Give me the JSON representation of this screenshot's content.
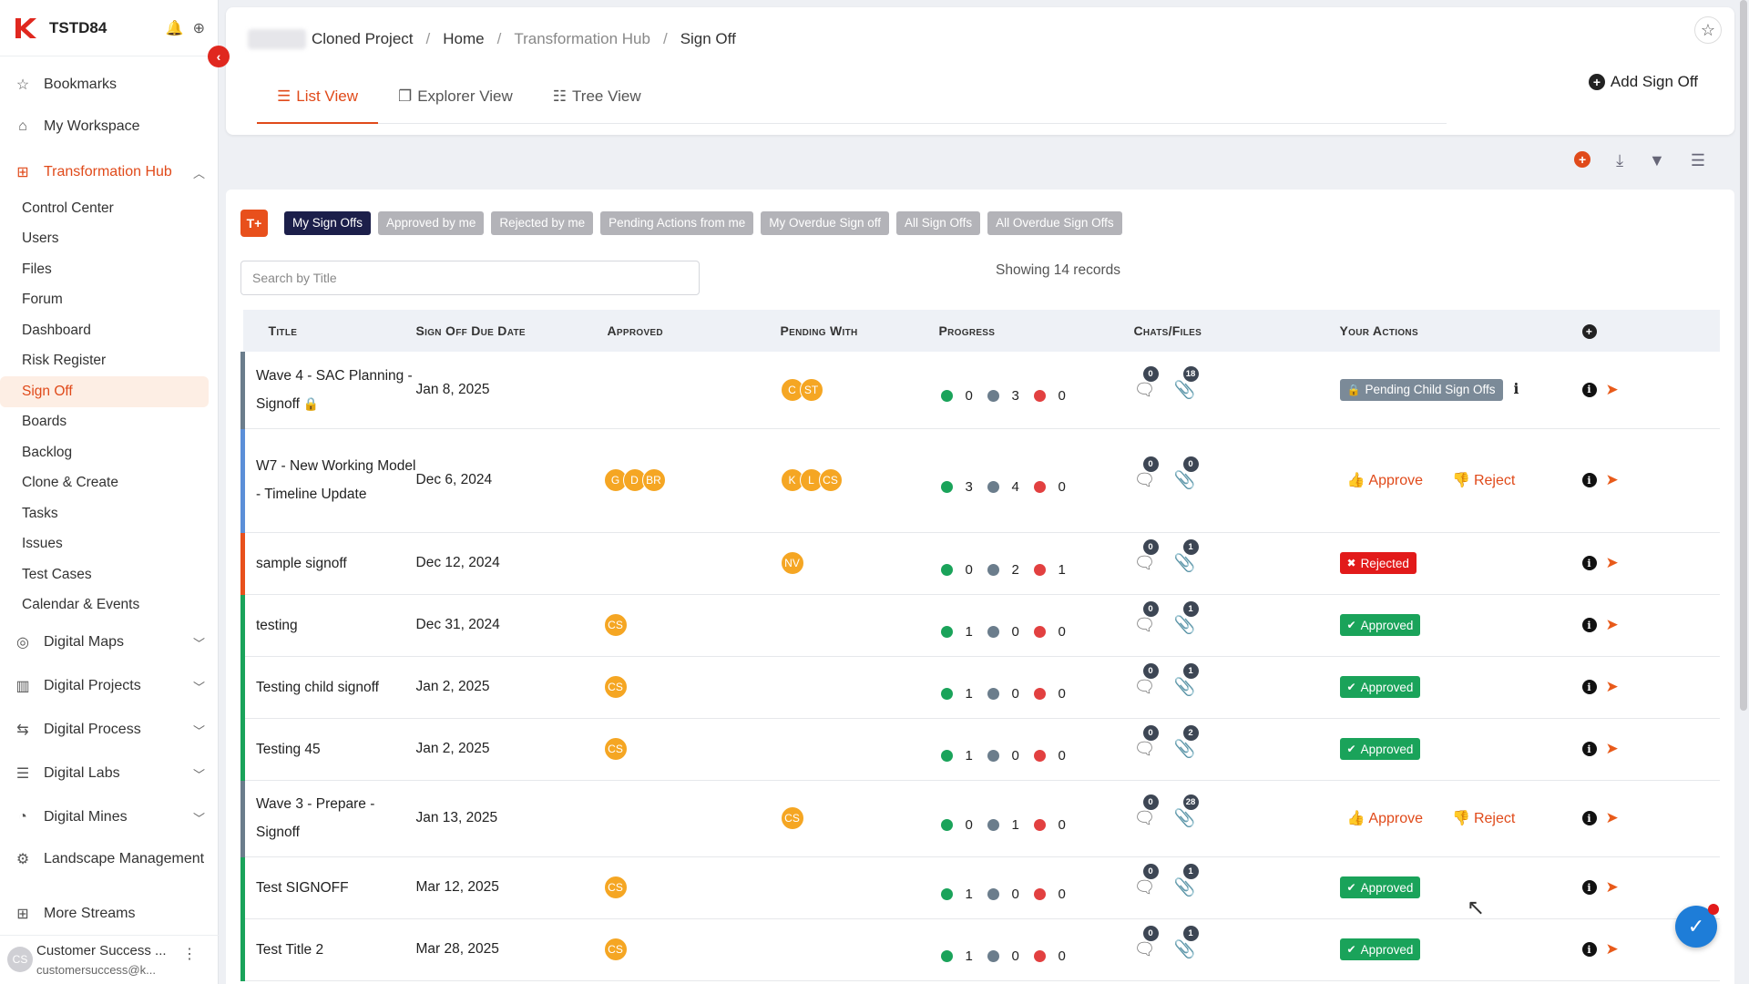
{
  "app": {
    "workspace": "TSTD84",
    "brand_color": "#e04a1a"
  },
  "sidebar": {
    "top_items": [
      {
        "label": "Bookmarks",
        "icon": "star-icon"
      },
      {
        "label": "My Workspace",
        "icon": "home-icon"
      }
    ],
    "hub": {
      "label": "Transformation Hub",
      "icon": "grid-icon"
    },
    "sub_items": [
      "Control Center",
      "Users",
      "Files",
      "Forum",
      "Dashboard",
      "Risk Register",
      "Sign Off",
      "Boards",
      "Backlog",
      "Clone & Create",
      "Tasks",
      "Issues",
      "Test Cases",
      "Calendar & Events"
    ],
    "active_sub": "Sign Off",
    "bottom_items": [
      {
        "label": "Digital Maps",
        "icon": "map-pin-icon"
      },
      {
        "label": "Digital Projects",
        "icon": "kanban-icon"
      },
      {
        "label": "Digital Process",
        "icon": "arrows-icon"
      },
      {
        "label": "Digital Labs",
        "icon": "list-icon"
      },
      {
        "label": "Digital Mines",
        "icon": "gauge-icon"
      },
      {
        "label": "Landscape Management",
        "icon": "gear-icon"
      },
      {
        "label": "More Streams",
        "icon": "grid-icon"
      }
    ],
    "user": {
      "initials": "CS",
      "name": "Customer Success ...",
      "email": "customersuccess@k..."
    }
  },
  "header": {
    "breadcrumb": [
      "Cloned Project",
      "Home",
      "Transformation Hub",
      "Sign Off"
    ],
    "tabs": [
      {
        "label": "List View",
        "icon": "list-icon"
      },
      {
        "label": "Explorer View",
        "icon": "box-icon"
      },
      {
        "label": "Tree View",
        "icon": "sitemap-icon"
      }
    ],
    "add_label": "Add Sign Off"
  },
  "filters": {
    "chips": [
      "My Sign Offs",
      "Approved by me",
      "Rejected by me",
      "Pending Actions from me",
      "My Overdue Sign off",
      "All Sign Offs",
      "All Overdue Sign Offs"
    ],
    "active": "My Sign Offs"
  },
  "search": {
    "placeholder": "Search by Title"
  },
  "records_label": "Showing 14 records",
  "table": {
    "columns": [
      "Title",
      "Sign Off Due Date",
      "Approved",
      "Pending With",
      "Progress",
      "Chats/Files",
      "Your Actions"
    ],
    "rows": [
      {
        "title": "Wave 4 - SAC Planning - Signoff",
        "locked": true,
        "bar": "#6b7d8c",
        "due": "Jan 8, 2025",
        "approved": [],
        "pending": [
          "C",
          "ST"
        ],
        "progress": [
          0,
          3,
          0
        ],
        "chats": 0,
        "files": 18,
        "action": "pending",
        "action_label": "Pending Child Sign Offs",
        "h": 84
      },
      {
        "title": "W7 - New Working Model - Timeline Update",
        "locked": false,
        "bar": "#5b8fd8",
        "due": "Dec 6, 2024",
        "approved": [
          "G",
          "D",
          "BR"
        ],
        "pending": [
          "K",
          "L",
          "CS"
        ],
        "progress": [
          3,
          4,
          0
        ],
        "chats": 0,
        "files": 0,
        "action": "approve_reject",
        "h": 114
      },
      {
        "title": "sample signoff",
        "locked": false,
        "bar": "#e8501c",
        "due": "Dec 12, 2024",
        "approved": [],
        "pending": [
          "NV"
        ],
        "progress": [
          0,
          2,
          1
        ],
        "chats": 0,
        "files": 1,
        "action": "rejected",
        "action_label": "Rejected",
        "h": 68
      },
      {
        "title": "testing",
        "locked": false,
        "bar": "#1aa35a",
        "due": "Dec 31, 2024",
        "approved": [
          "CS"
        ],
        "pending": [],
        "progress": [
          1,
          0,
          0
        ],
        "chats": 0,
        "files": 1,
        "action": "approved",
        "action_label": "Approved",
        "h": 68
      },
      {
        "title": "Testing child signoff",
        "locked": false,
        "bar": "#1aa35a",
        "due": "Jan 2, 2025",
        "approved": [
          "CS"
        ],
        "pending": [],
        "progress": [
          1,
          0,
          0
        ],
        "chats": 0,
        "files": 1,
        "action": "approved",
        "action_label": "Approved",
        "h": 68
      },
      {
        "title": "Testing 45",
        "locked": false,
        "bar": "#1aa35a",
        "due": "Jan 2, 2025",
        "approved": [
          "CS"
        ],
        "pending": [],
        "progress": [
          1,
          0,
          0
        ],
        "chats": 0,
        "files": 2,
        "action": "approved",
        "action_label": "Approved",
        "h": 68
      },
      {
        "title": "Wave 3 - Prepare - Signoff",
        "locked": false,
        "bar": "#6b7d8c",
        "due": "Jan 13, 2025",
        "approved": [],
        "pending": [
          "CS"
        ],
        "progress": [
          0,
          1,
          0
        ],
        "chats": 0,
        "files": 28,
        "action": "approve_reject",
        "h": 84
      },
      {
        "title": "Test SIGNOFF",
        "locked": false,
        "bar": "#1aa35a",
        "due": "Mar 12, 2025",
        "approved": [
          "CS"
        ],
        "pending": [],
        "progress": [
          1,
          0,
          0
        ],
        "chats": 0,
        "files": 1,
        "action": "approved",
        "action_label": "Approved",
        "h": 68
      },
      {
        "title": "Test Title 2",
        "locked": false,
        "bar": "#1aa35a",
        "due": "Mar 28, 2025",
        "approved": [
          "CS"
        ],
        "pending": [],
        "progress": [
          1,
          0,
          0
        ],
        "chats": 0,
        "files": 1,
        "action": "approved",
        "action_label": "Approved",
        "h": 68
      }
    ],
    "approve_label": "Approve",
    "reject_label": "Reject"
  }
}
